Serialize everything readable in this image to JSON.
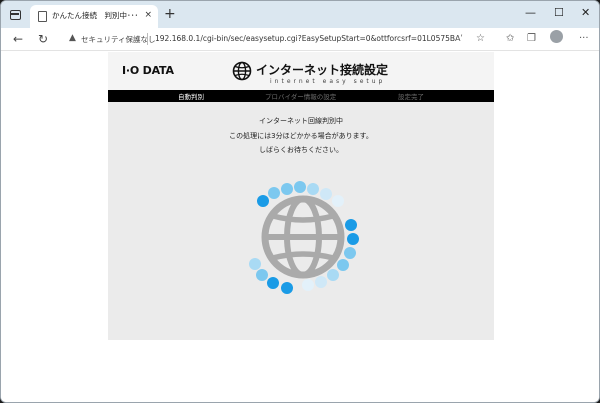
{
  "browser": {
    "tab_title": "かんたん接続　判別中･･･",
    "tab_close": "×",
    "new_tab": "+",
    "window_minimize": "—",
    "window_maximize": "☐",
    "window_close": "✕",
    "security_label": "セキュリティ保護なし",
    "url": "192.168.0.1/cgi-bin/sec/easysetup.cgi?EasySetupStart=0&ottforcsrf=01L0575BH5334...",
    "read_aloud": "Aʹ"
  },
  "page": {
    "logo": "I·O DATA",
    "title": "インターネット接続設定",
    "subtitle": "internet easy setup",
    "steps": [
      {
        "label": "自動判別",
        "state": "active"
      },
      {
        "label": "プロバイダー情報の設定",
        "state": "inactive"
      },
      {
        "label": "設定完了",
        "state": "inactive"
      }
    ],
    "messages": [
      "インターネット回線判別中",
      "この処理には3分ほどかかる場合があります。",
      "しばらくお待ちください。"
    ]
  },
  "colors": {
    "spinner_dark": "#1a9be6",
    "spinner_mid": "#7cc8ef",
    "spinner_light": "#cfe8f7",
    "globe": "#aaaaaa"
  }
}
